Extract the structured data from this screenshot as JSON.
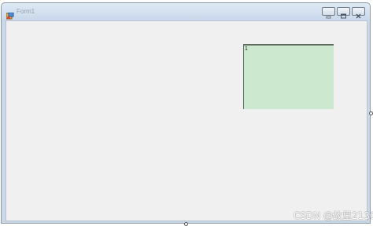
{
  "window": {
    "title": "Form1",
    "icons": {
      "app": "form-icon",
      "minimize": "minimize-icon",
      "maximize": "maximize-icon",
      "close": "close-icon"
    }
  },
  "panel": {
    "label": "1",
    "color": "#cce8cf"
  },
  "colors": {
    "client_background": "#f0f0f0",
    "title_text": "#9aa3ad"
  },
  "watermark": {
    "text": "CSDN @故里2130"
  }
}
